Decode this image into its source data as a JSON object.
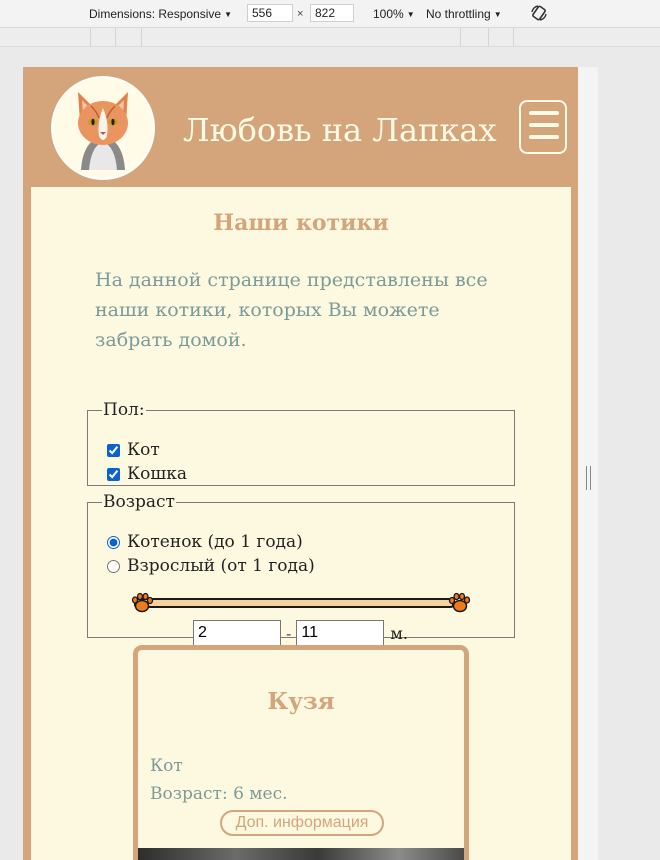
{
  "devtools": {
    "dimensions_label": "Dimensions: Responsive",
    "width": "556",
    "height": "822",
    "times": "×",
    "zoom": "100%",
    "throttling": "No throttling"
  },
  "site": {
    "title": "Любовь на Лапках"
  },
  "page": {
    "heading": "Наши котики",
    "intro": "На данной странице представлены все наши котики, которых Вы можете забрать домой."
  },
  "filters": {
    "sex": {
      "legend": "Пол:",
      "options": [
        {
          "label": "Кот",
          "checked": true
        },
        {
          "label": "Кошка",
          "checked": true
        }
      ]
    },
    "age": {
      "legend": "Возраст",
      "options": [
        {
          "label": "Котенок (до 1 года)",
          "selected": true
        },
        {
          "label": "Взрослый (от 1 года)",
          "selected": false
        }
      ],
      "min": "2",
      "max": "11",
      "dash": "-",
      "unit": "м."
    }
  },
  "cards": [
    {
      "name": "Кузя",
      "sex": "Кот",
      "age": "Возраст: 6 мес.",
      "button": "Доп. информация"
    }
  ],
  "colors": {
    "brand": "#d4a57a",
    "background": "#fdf9e1",
    "text_muted": "#7b9a98"
  }
}
